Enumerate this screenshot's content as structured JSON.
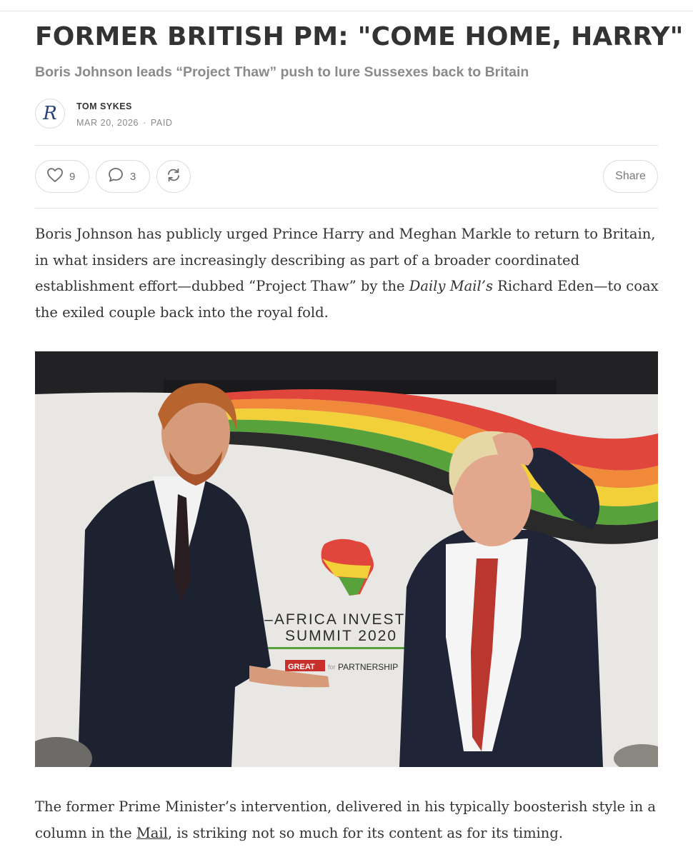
{
  "article": {
    "title": "FORMER BRITISH PM: \"COME HOME, HARRY\"",
    "subtitle": "Boris Johnson leads “Project Thaw” push to lure Sussexes back to Britain",
    "avatar_letter": "R",
    "author": "TOM SYKES",
    "date": "MAR 20, 2026",
    "access": "PAID"
  },
  "actions": {
    "like_count": "9",
    "comment_count": "3",
    "share_label": "Share",
    "icons": [
      "heart-icon",
      "comment-icon",
      "restack-icon"
    ]
  },
  "body": {
    "p1_before": "Boris Johnson has publicly urged Prince Harry and Meghan Markle to return to Britain, in what insiders are increasingly describing as part of a broader coordinated establishment effort—dubbed “Project Thaw” by the ",
    "p1_em": "Daily Mail’s",
    "p1_after": " Richard Eden—to coax the exiled couple back into the royal fold.",
    "p2_before": "The former Prime Minister’s intervention, delivered in his typically boosterish style in a column in the ",
    "p2_link": "Mail",
    "p2_after": ", is striking not so much for its content as for its timing."
  },
  "photo": {
    "banner_line1": "UK–AFRICA INVESTME",
    "banner_line2": "SUMMIT 2020",
    "banner_great": "GREAT",
    "banner_for": "for",
    "banner_partnership": "PARTNERSHIP"
  },
  "colors": {
    "title": "#333333",
    "subtitle": "#8a8a8a",
    "avatar_letter": "#27427a",
    "stripe_red": "#e0463b",
    "stripe_orange": "#f08a3a",
    "stripe_yellow": "#f2d03a",
    "stripe_green": "#58a23c"
  }
}
